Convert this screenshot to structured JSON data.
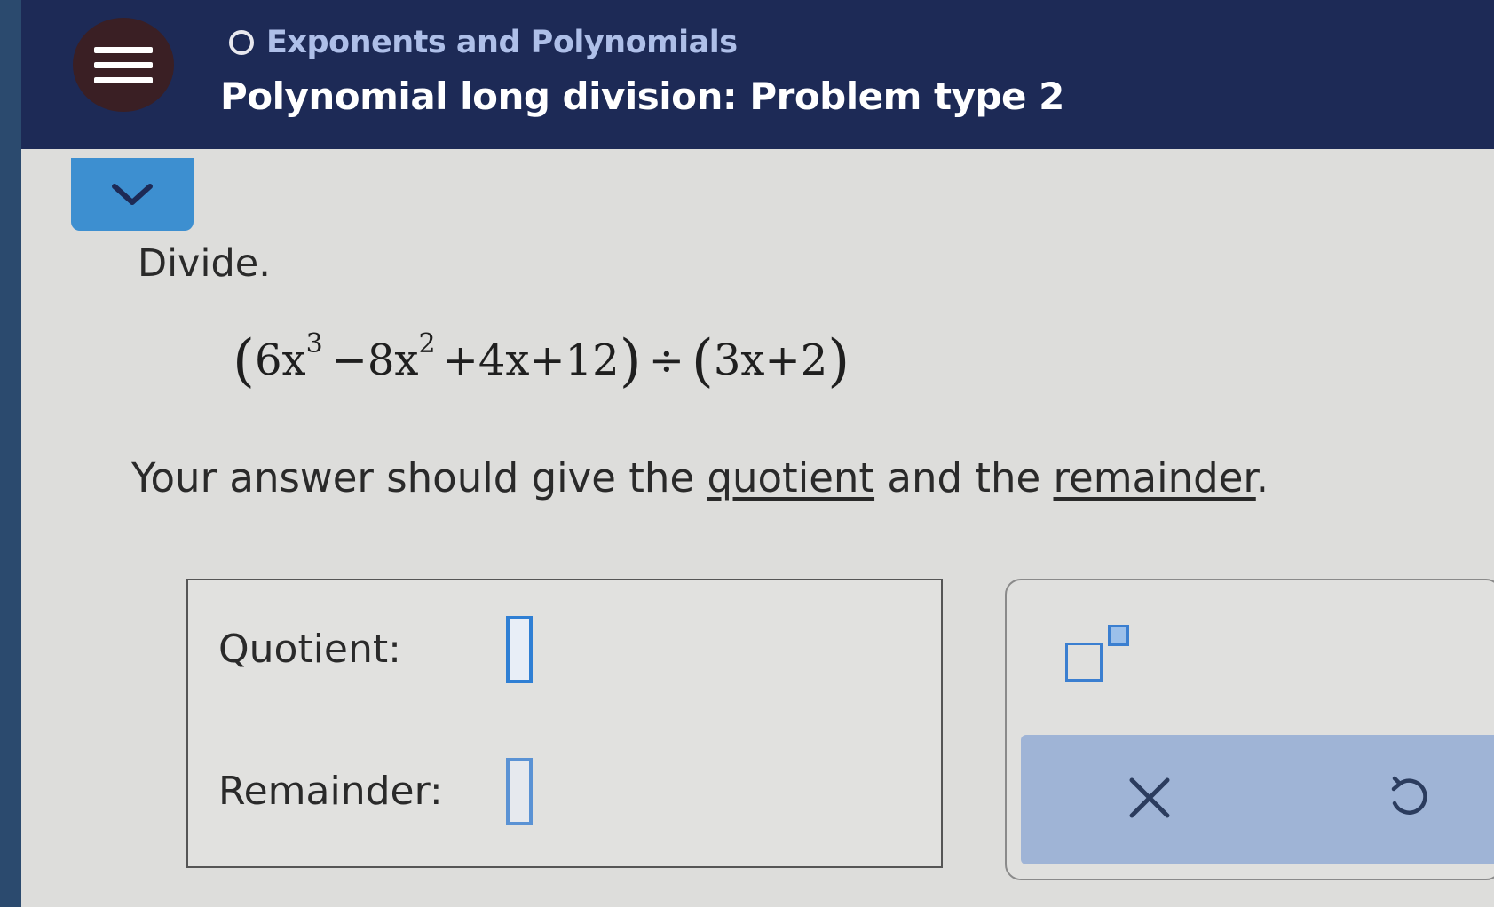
{
  "header": {
    "topic": "Exponents and Polynomials",
    "title": "Polynomial long division: Problem type 2"
  },
  "problem": {
    "prompt": "Divide.",
    "equation": {
      "dividend_terms": [
        "6x",
        "3",
        "−8x",
        "2",
        "+4x+12"
      ],
      "operator": "÷",
      "divisor": "3x+2"
    },
    "instruction_parts": [
      "Your answer should give the ",
      "quotient",
      " and the ",
      "remainder",
      "."
    ]
  },
  "answer": {
    "quotient_label": "Quotient:",
    "remainder_label": "Remainder:"
  },
  "colors": {
    "header_bg": "#1d2a56",
    "accent": "#3d8fd0",
    "input_border": "#2f7fd4"
  },
  "icons": [
    "hamburger-menu-icon",
    "topic-progress-icon",
    "chevron-down-icon",
    "superscript-icon",
    "clear-x-icon",
    "undo-icon"
  ]
}
